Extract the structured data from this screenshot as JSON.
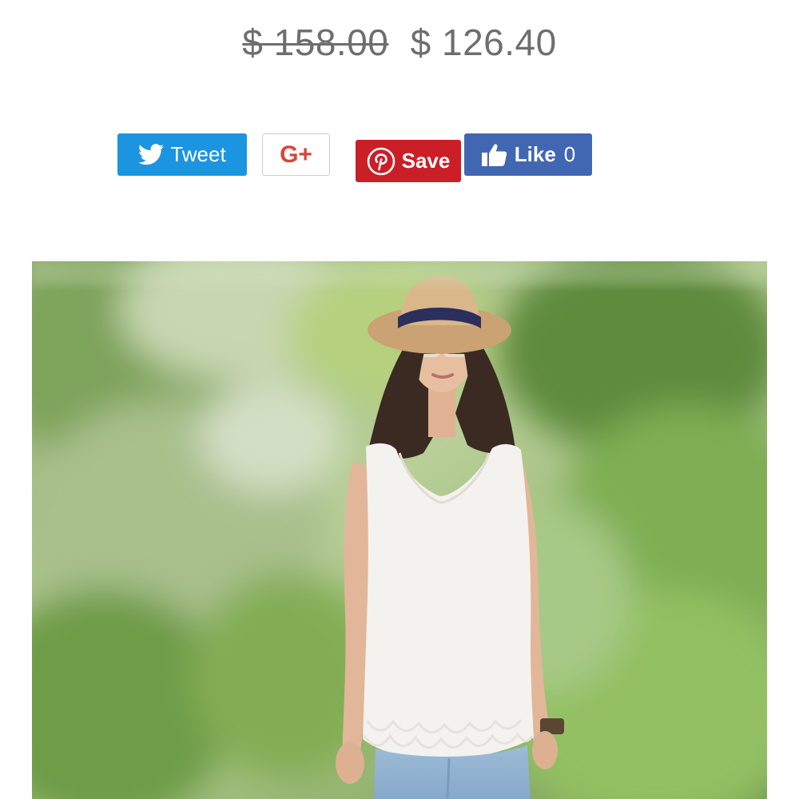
{
  "price": {
    "original": "$ 158.00",
    "sale": "$ 126.40"
  },
  "share": {
    "tweet": {
      "label": "Tweet",
      "icon": "twitter-bird-icon"
    },
    "gplus": {
      "label": "G+",
      "icon": "google-plus-icon"
    },
    "pinterest": {
      "label": "Save",
      "icon": "pinterest-icon"
    },
    "facebook": {
      "label": "Like",
      "count": "0",
      "icon": "thumbs-up-icon"
    }
  },
  "colors": {
    "twitter": "#1b95e0",
    "google": "#db4437",
    "pinterest": "#cb1f27",
    "facebook": "#4267b2",
    "price_text": "#6e6e6e"
  }
}
